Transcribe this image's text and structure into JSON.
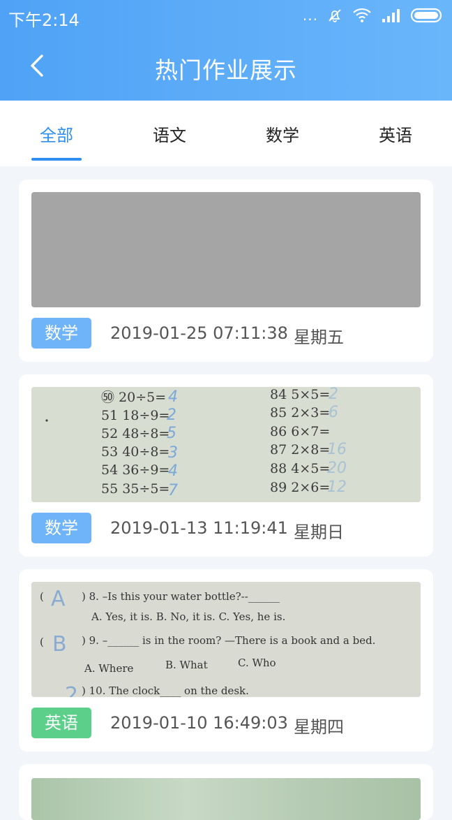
{
  "status": {
    "time": "下午2:14",
    "dots": "..."
  },
  "header": {
    "title": "热门作业展示"
  },
  "tabs": [
    {
      "label": "全部",
      "active": true
    },
    {
      "label": "语文",
      "active": false
    },
    {
      "label": "数学",
      "active": false
    },
    {
      "label": "英语",
      "active": false
    }
  ],
  "cards": [
    {
      "subject": "数学",
      "date": "2019-01-25 07:11:38",
      "weekday": "星期五"
    },
    {
      "subject": "数学",
      "date": "2019-01-13 11:19:41",
      "weekday": "星期日",
      "photo_lines_left": [
        "㊿ 20÷5=",
        "51 18÷9=",
        "52 48÷8=",
        "53 40÷8=",
        "54 36÷9=",
        "55 35÷5="
      ],
      "photo_lines_right": [
        "84 5×5=",
        "85 2×3=",
        "86 6×7=",
        "87 2×8=",
        "88 4×5=",
        "89 2×6="
      ],
      "photo_answers_left": [
        "4",
        "2",
        "5",
        "3",
        "4",
        "7"
      ],
      "photo_answers_right": [
        "2",
        "6",
        "",
        "16",
        "20",
        "12"
      ]
    },
    {
      "subject": "英语",
      "date": "2019-01-10 16:49:03",
      "weekday": "星期四",
      "photo_q8": ") 8. –Is this your water bottle?--______",
      "photo_q8_opts": "A. Yes, it is.   B. No, it is.   C. Yes, he is.",
      "photo_q9": ") 9. –______ is in the room?   —There is a book and a bed.",
      "photo_q9_opts_a": "A. Where",
      "photo_q9_opts_b": "B. What",
      "photo_q9_opts_c": "C. Who",
      "photo_q10": ") 10. The clock____ on the desk.",
      "photo_hw_a": "A",
      "photo_hw_b": "B",
      "photo_hw_c": "2"
    }
  ],
  "colors": {
    "accent": "#2e8ff0",
    "math_badge": "#6fb4f8",
    "english_badge": "#5ccf8a"
  }
}
